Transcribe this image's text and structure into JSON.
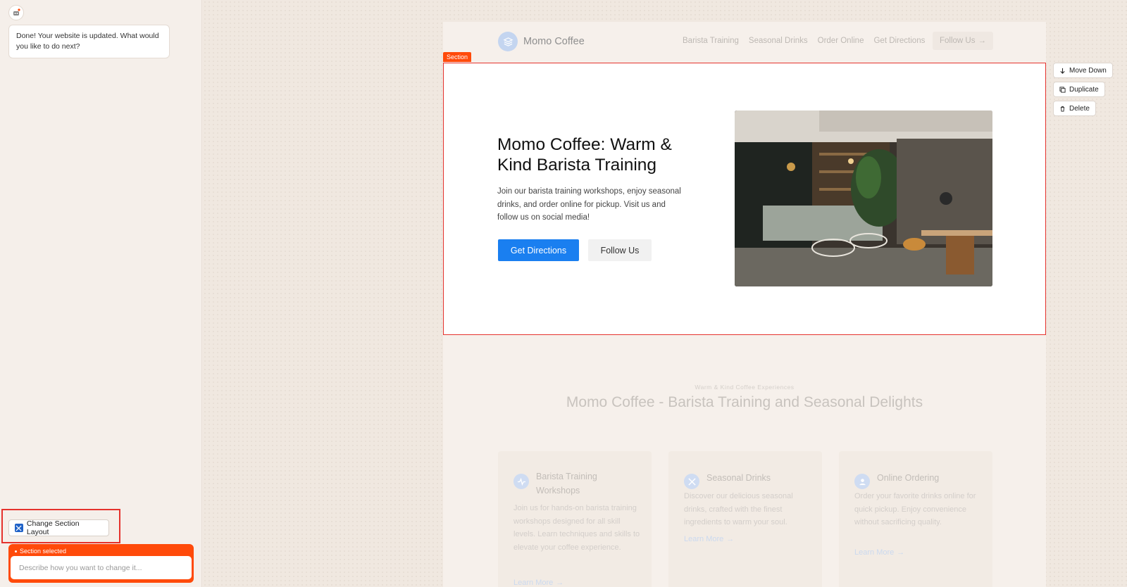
{
  "chat": {
    "message": "Done! Your website is updated. What would you like to do next?",
    "change_layout_label": "Change Section Layout",
    "section_selected_label": "Section selected",
    "input_placeholder": "Describe how you want to change it..."
  },
  "site": {
    "brand": "Momo Coffee",
    "nav": [
      "Barista Training",
      "Seasonal Drinks",
      "Order Online",
      "Get Directions"
    ],
    "nav_follow": "Follow Us"
  },
  "section_tag": "Section",
  "section_actions": {
    "move_down": "Move Down",
    "duplicate": "Duplicate",
    "delete": "Delete"
  },
  "hero": {
    "title": "Momo Coffee: Warm & Kind Barista Training",
    "description": "Join our barista training workshops, enjoy seasonal drinks, and order online for pickup. Visit us and follow us on social media!",
    "primary_button": "Get Directions",
    "secondary_button": "Follow Us"
  },
  "features": {
    "subtitle": "Warm & Kind Coffee Experiences",
    "title": "Momo Coffee - Barista Training and Seasonal Delights",
    "cards": [
      {
        "title": "Barista Training Workshops",
        "description": "Join us for hands-on barista training workshops designed for all skill levels. Learn techniques and skills to elevate your coffee experience.",
        "link": "Learn More",
        "icon": "activity-icon"
      },
      {
        "title": "Seasonal Drinks",
        "description": "Discover our delicious seasonal drinks, crafted with the finest ingredients to warm your soul.",
        "link": "Learn More",
        "icon": "tools-icon"
      },
      {
        "title": "Online Ordering",
        "description": "Order your favorite drinks online for quick pickup. Enjoy convenience without sacrificing quality.",
        "link": "Learn More",
        "icon": "user-icon"
      }
    ]
  },
  "colors": {
    "accent": "#ff4a0a",
    "selection_border": "#e5322d",
    "primary_button": "#1a7ff0"
  }
}
